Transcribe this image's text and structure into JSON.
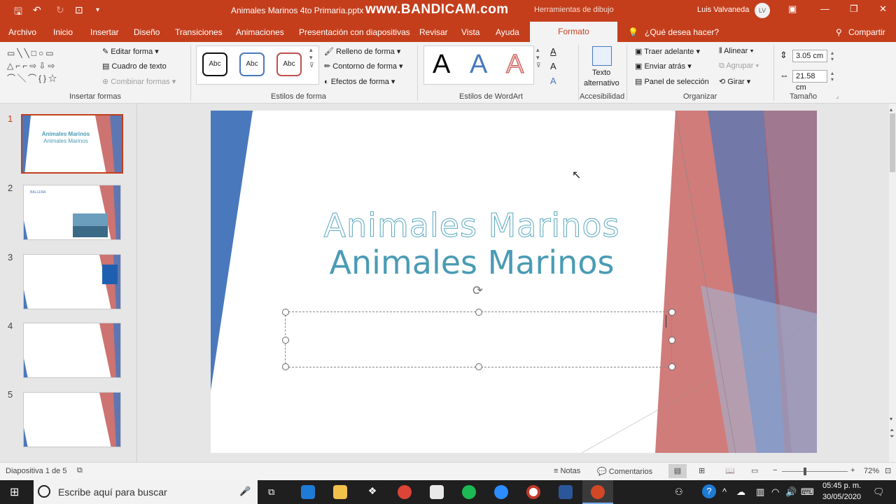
{
  "titlebar": {
    "filename": "Animales Marinos 4to Primaria.pptx",
    "watermark": "www.BANDICAM.com",
    "tools_context": "Herramientas de dibujo",
    "user_name": "Luis Valvaneda",
    "user_initials": "LV"
  },
  "tabs": [
    "Archivo",
    "Inicio",
    "Insertar",
    "Diseño",
    "Transiciones",
    "Animaciones",
    "Presentación con diapositivas",
    "Revisar",
    "Vista",
    "Ayuda"
  ],
  "active_tab": "Formato",
  "tell_me": "¿Qué desea hacer?",
  "share": "Compartir",
  "ribbon": {
    "insert_shapes": {
      "edit_shape": "Editar forma",
      "text_box": "Cuadro de texto",
      "merge_shapes": "Combinar formas",
      "label": "Insertar formas"
    },
    "shape_styles": {
      "sample": "Abc",
      "fill": "Relleno de forma",
      "outline": "Contorno de forma",
      "effects": "Efectos de forma",
      "label": "Estilos de forma"
    },
    "wordart": {
      "sample": "A",
      "label": "Estilos de WordArt"
    },
    "accessibility": {
      "alt_text_1": "Texto",
      "alt_text_2": "alternativo",
      "label": "Accesibilidad"
    },
    "arrange": {
      "bring_forward": "Traer adelante",
      "send_backward": "Enviar atrás",
      "selection_pane": "Panel de selección",
      "align": "Alinear",
      "group": "Agrupar",
      "rotate": "Girar",
      "label": "Organizar"
    },
    "size": {
      "height": "3.05 cm",
      "width": "21.58 cm",
      "label": "Tamaño"
    }
  },
  "thumbnails": [
    {
      "number": "1",
      "title": "Animales Marinos",
      "subtitle": "Animales Marinos"
    },
    {
      "number": "2",
      "title": "BALLENA"
    },
    {
      "number": "3"
    },
    {
      "number": "4"
    },
    {
      "number": "5"
    }
  ],
  "slide": {
    "title": "Animales Marinos",
    "subtitle": "Animales Marinos"
  },
  "status": {
    "slide_indicator": "Diapositiva 1 de 5",
    "notes": "Notas",
    "comments": "Comentarios",
    "zoom": "72%"
  },
  "taskbar": {
    "search_placeholder": "Escribe aquí para buscar",
    "time": "05:45 p. m.",
    "date": "30/05/2020"
  },
  "colors": {
    "accent": "#c43e1c",
    "slide_blue": "#4a78bd",
    "slide_red": "#c0504d"
  }
}
